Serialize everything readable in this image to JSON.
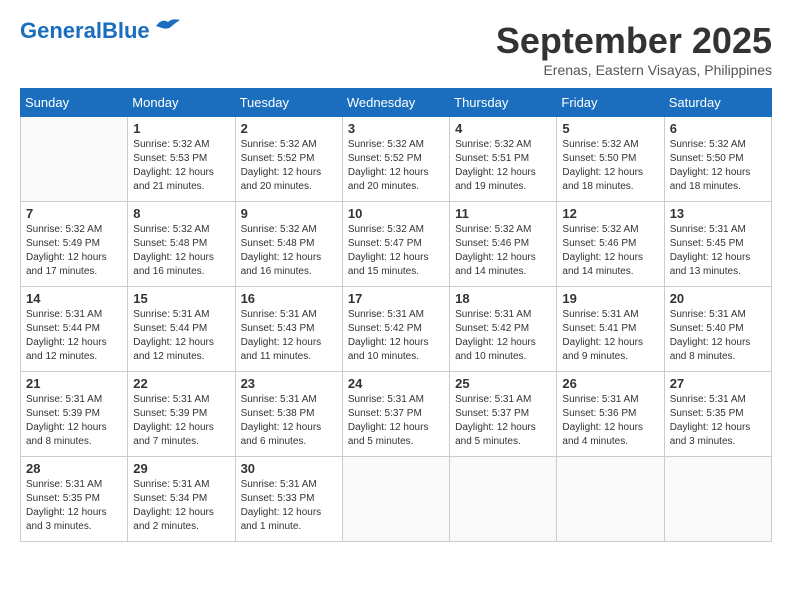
{
  "header": {
    "logo_general": "General",
    "logo_blue": "Blue",
    "month_title": "September 2025",
    "subtitle": "Erenas, Eastern Visayas, Philippines"
  },
  "weekdays": [
    "Sunday",
    "Monday",
    "Tuesday",
    "Wednesday",
    "Thursday",
    "Friday",
    "Saturday"
  ],
  "weeks": [
    [
      {
        "day": "",
        "info": ""
      },
      {
        "day": "1",
        "info": "Sunrise: 5:32 AM\nSunset: 5:53 PM\nDaylight: 12 hours\nand 21 minutes."
      },
      {
        "day": "2",
        "info": "Sunrise: 5:32 AM\nSunset: 5:52 PM\nDaylight: 12 hours\nand 20 minutes."
      },
      {
        "day": "3",
        "info": "Sunrise: 5:32 AM\nSunset: 5:52 PM\nDaylight: 12 hours\nand 20 minutes."
      },
      {
        "day": "4",
        "info": "Sunrise: 5:32 AM\nSunset: 5:51 PM\nDaylight: 12 hours\nand 19 minutes."
      },
      {
        "day": "5",
        "info": "Sunrise: 5:32 AM\nSunset: 5:50 PM\nDaylight: 12 hours\nand 18 minutes."
      },
      {
        "day": "6",
        "info": "Sunrise: 5:32 AM\nSunset: 5:50 PM\nDaylight: 12 hours\nand 18 minutes."
      }
    ],
    [
      {
        "day": "7",
        "info": "Sunrise: 5:32 AM\nSunset: 5:49 PM\nDaylight: 12 hours\nand 17 minutes."
      },
      {
        "day": "8",
        "info": "Sunrise: 5:32 AM\nSunset: 5:48 PM\nDaylight: 12 hours\nand 16 minutes."
      },
      {
        "day": "9",
        "info": "Sunrise: 5:32 AM\nSunset: 5:48 PM\nDaylight: 12 hours\nand 16 minutes."
      },
      {
        "day": "10",
        "info": "Sunrise: 5:32 AM\nSunset: 5:47 PM\nDaylight: 12 hours\nand 15 minutes."
      },
      {
        "day": "11",
        "info": "Sunrise: 5:32 AM\nSunset: 5:46 PM\nDaylight: 12 hours\nand 14 minutes."
      },
      {
        "day": "12",
        "info": "Sunrise: 5:32 AM\nSunset: 5:46 PM\nDaylight: 12 hours\nand 14 minutes."
      },
      {
        "day": "13",
        "info": "Sunrise: 5:31 AM\nSunset: 5:45 PM\nDaylight: 12 hours\nand 13 minutes."
      }
    ],
    [
      {
        "day": "14",
        "info": "Sunrise: 5:31 AM\nSunset: 5:44 PM\nDaylight: 12 hours\nand 12 minutes."
      },
      {
        "day": "15",
        "info": "Sunrise: 5:31 AM\nSunset: 5:44 PM\nDaylight: 12 hours\nand 12 minutes."
      },
      {
        "day": "16",
        "info": "Sunrise: 5:31 AM\nSunset: 5:43 PM\nDaylight: 12 hours\nand 11 minutes."
      },
      {
        "day": "17",
        "info": "Sunrise: 5:31 AM\nSunset: 5:42 PM\nDaylight: 12 hours\nand 10 minutes."
      },
      {
        "day": "18",
        "info": "Sunrise: 5:31 AM\nSunset: 5:42 PM\nDaylight: 12 hours\nand 10 minutes."
      },
      {
        "day": "19",
        "info": "Sunrise: 5:31 AM\nSunset: 5:41 PM\nDaylight: 12 hours\nand 9 minutes."
      },
      {
        "day": "20",
        "info": "Sunrise: 5:31 AM\nSunset: 5:40 PM\nDaylight: 12 hours\nand 8 minutes."
      }
    ],
    [
      {
        "day": "21",
        "info": "Sunrise: 5:31 AM\nSunset: 5:39 PM\nDaylight: 12 hours\nand 8 minutes."
      },
      {
        "day": "22",
        "info": "Sunrise: 5:31 AM\nSunset: 5:39 PM\nDaylight: 12 hours\nand 7 minutes."
      },
      {
        "day": "23",
        "info": "Sunrise: 5:31 AM\nSunset: 5:38 PM\nDaylight: 12 hours\nand 6 minutes."
      },
      {
        "day": "24",
        "info": "Sunrise: 5:31 AM\nSunset: 5:37 PM\nDaylight: 12 hours\nand 5 minutes."
      },
      {
        "day": "25",
        "info": "Sunrise: 5:31 AM\nSunset: 5:37 PM\nDaylight: 12 hours\nand 5 minutes."
      },
      {
        "day": "26",
        "info": "Sunrise: 5:31 AM\nSunset: 5:36 PM\nDaylight: 12 hours\nand 4 minutes."
      },
      {
        "day": "27",
        "info": "Sunrise: 5:31 AM\nSunset: 5:35 PM\nDaylight: 12 hours\nand 3 minutes."
      }
    ],
    [
      {
        "day": "28",
        "info": "Sunrise: 5:31 AM\nSunset: 5:35 PM\nDaylight: 12 hours\nand 3 minutes."
      },
      {
        "day": "29",
        "info": "Sunrise: 5:31 AM\nSunset: 5:34 PM\nDaylight: 12 hours\nand 2 minutes."
      },
      {
        "day": "30",
        "info": "Sunrise: 5:31 AM\nSunset: 5:33 PM\nDaylight: 12 hours\nand 1 minute."
      },
      {
        "day": "",
        "info": ""
      },
      {
        "day": "",
        "info": ""
      },
      {
        "day": "",
        "info": ""
      },
      {
        "day": "",
        "info": ""
      }
    ]
  ]
}
